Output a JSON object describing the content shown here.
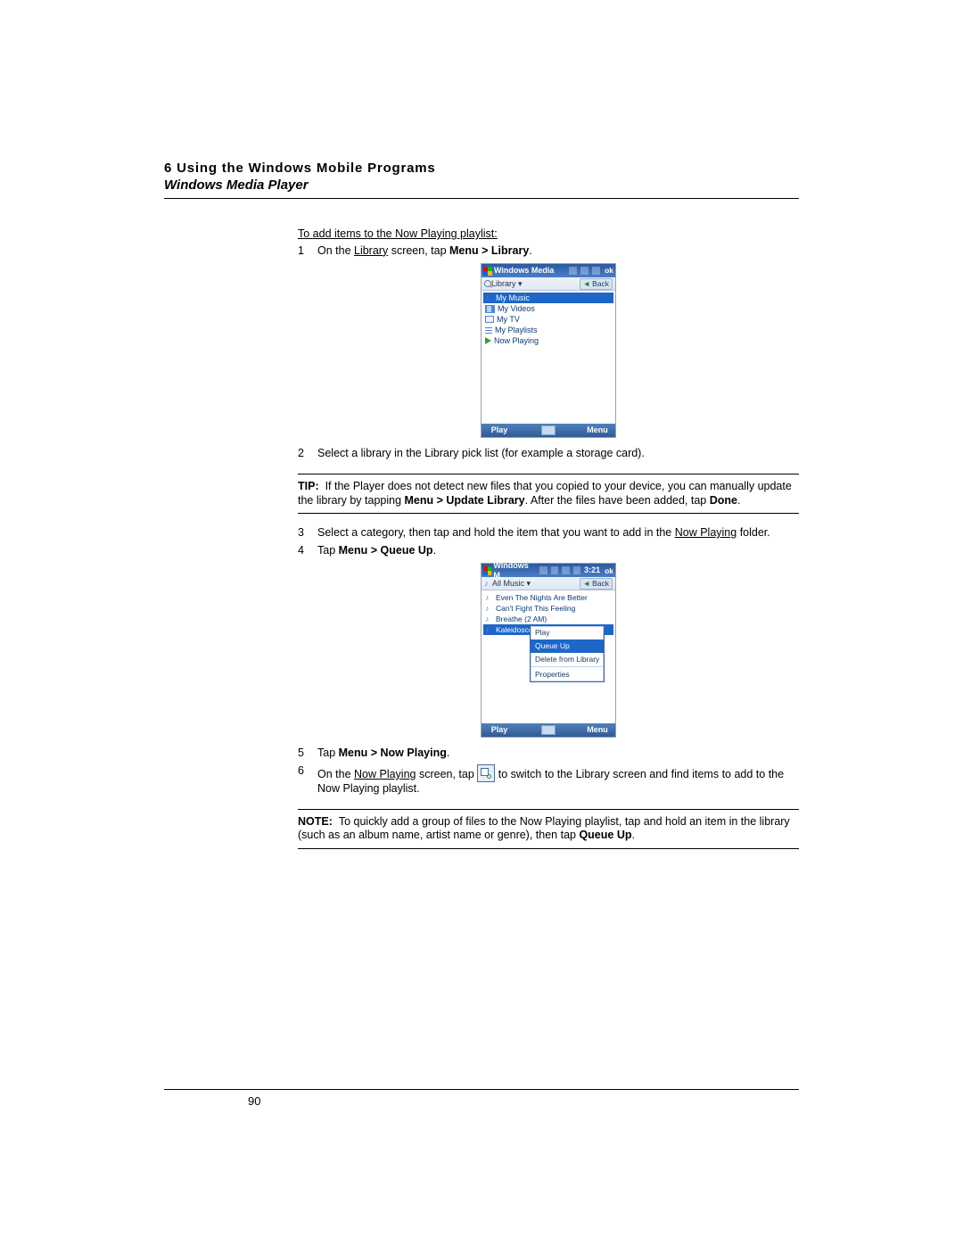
{
  "header": {
    "chapter_line": "6 Using the Windows Mobile Programs",
    "section_line": "Windows Media Player"
  },
  "subhead": "To add items to the Now Playing playlist:",
  "steps": {
    "s1_pre": "On the ",
    "s1_lib": "Library",
    "s1_mid": " screen, tap ",
    "s1_bold": "Menu > Library",
    "s2": "Select a library in the Library pick list (for example a storage card).",
    "s3_pre": "Select a category, then tap and hold the item that you want to add in the ",
    "s3_np": "Now Playing",
    "s3_post": " folder.",
    "s4_pre": "Tap ",
    "s4_bold": "Menu > Queue Up",
    "s5_pre": "Tap ",
    "s5_bold": "Menu > Now Playing",
    "s6_pre": "On the ",
    "s6_np": "Now Playing",
    "s6_mid": " screen, tap ",
    "s6_post": " to switch to the Library screen and find items to add to the Now Playing playlist."
  },
  "tip": {
    "label": "TIP:",
    "t1": "If the Player does not detect new files that you copied to your device, you can manually update the library by tapping ",
    "t1b": "Menu > Update Library",
    "t2": ". After the files have been added, tap ",
    "t2b": "Done"
  },
  "note": {
    "label": "NOTE:",
    "n1": "To quickly add a group of files to the Now Playing playlist, tap and hold an item in the library (such as an album name, artist name or genre), then tap ",
    "n1b": "Queue Up"
  },
  "shot1": {
    "title": "Windows Media",
    "time_ok": "ok",
    "subbar": "Library",
    "back": "Back",
    "rows": [
      "My Music",
      "My Videos",
      "My TV",
      "My Playlists",
      "Now Playing"
    ],
    "soft_left": "Play",
    "soft_right": "Menu"
  },
  "shot2": {
    "title": "Windows M",
    "time": "3:21",
    "ok": "ok",
    "subbar": "All Music",
    "back": "Back",
    "tracks": [
      "Even The Nights Are Better",
      "Can't Fight This Feeling",
      "Breathe (2 AM)",
      "Kaleidoscope"
    ],
    "ctx": {
      "play": "Play",
      "queue": "Queue Up",
      "del": "Delete from Library",
      "prop": "Properties"
    },
    "soft_left": "Play",
    "soft_right": "Menu"
  },
  "pagenum": "90"
}
